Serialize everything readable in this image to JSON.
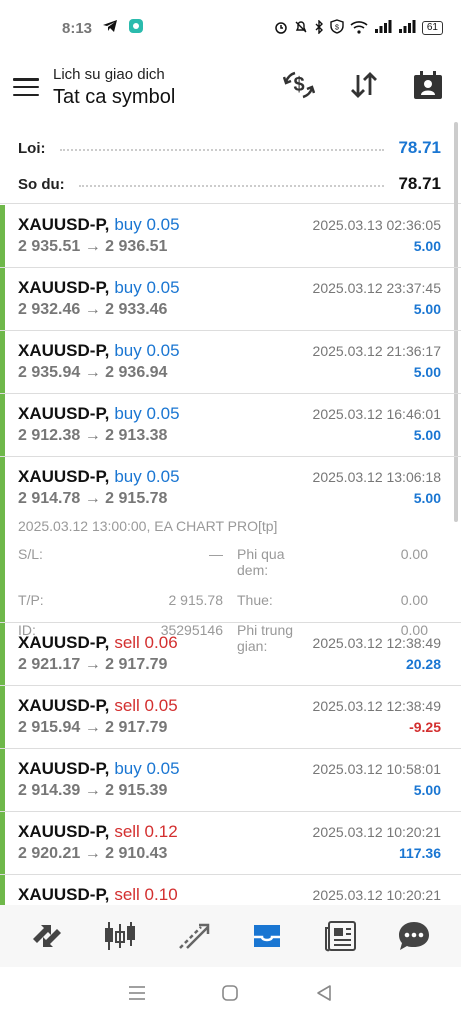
{
  "status_bar": {
    "time": "8:13",
    "battery": "61"
  },
  "header": {
    "subtitle": "Lich su giao dich",
    "title": "Tat ca symbol"
  },
  "summary": {
    "loi_label": "Loi:",
    "loi_value": "78.71",
    "sodu_label": "So du:",
    "sodu_value": "78.71"
  },
  "deals": [
    {
      "symbol": "XAUUSD-P,",
      "type": "buy 0.05",
      "side": "buy",
      "time": "2025.03.13 02:36:05",
      "prices": "2 935.51 → 2 936.51",
      "profit": "5.00",
      "profit_sign": "pos"
    },
    {
      "symbol": "XAUUSD-P,",
      "type": "buy 0.05",
      "side": "buy",
      "time": "2025.03.12 23:37:45",
      "prices": "2 932.46 → 2 933.46",
      "profit": "5.00",
      "profit_sign": "pos"
    },
    {
      "symbol": "XAUUSD-P,",
      "type": "buy 0.05",
      "side": "buy",
      "time": "2025.03.12 21:36:17",
      "prices": "2 935.94 → 2 936.94",
      "profit": "5.00",
      "profit_sign": "pos"
    },
    {
      "symbol": "XAUUSD-P,",
      "type": "buy 0.05",
      "side": "buy",
      "time": "2025.03.12 16:46:01",
      "prices": "2 912.38 → 2 913.38",
      "profit": "5.00",
      "profit_sign": "pos"
    },
    {
      "symbol": "XAUUSD-P,",
      "type": "buy 0.05",
      "side": "buy",
      "time": "2025.03.12 13:06:18",
      "prices": "2 914.78 → 2 915.78",
      "profit": "5.00",
      "profit_sign": "pos"
    },
    {
      "symbol": "XAUUSD-P,",
      "type": "sell 0.06",
      "side": "sell",
      "time": "2025.03.12 12:38:49",
      "prices": "2 921.17 → 2 917.79",
      "profit": "20.28",
      "profit_sign": "pos"
    },
    {
      "symbol": "XAUUSD-P,",
      "type": "sell 0.05",
      "side": "sell",
      "time": "2025.03.12 12:38:49",
      "prices": "2 915.94 → 2 917.79",
      "profit": "-9.25",
      "profit_sign": "neg"
    },
    {
      "symbol": "XAUUSD-P,",
      "type": "buy 0.05",
      "side": "buy",
      "time": "2025.03.12 10:58:01",
      "prices": "2 914.39 → 2 915.39",
      "profit": "5.00",
      "profit_sign": "pos"
    },
    {
      "symbol": "XAUUSD-P,",
      "type": "sell 0.12",
      "side": "sell",
      "time": "2025.03.12 10:20:21",
      "prices": "2 920.21 → 2 910.43",
      "profit": "117.36",
      "profit_sign": "pos"
    },
    {
      "symbol": "XAUUSD-P,",
      "type": "sell 0.10",
      "side": "sell",
      "time": "2025.03.12 10:20:21",
      "prices": "",
      "profit": "",
      "profit_sign": "pos"
    }
  ],
  "expanded": {
    "comment": "2025.03.12 13:00:00, EA CHART PRO[tp]",
    "sl_label": "S/L:",
    "sl_value": "—",
    "tp_label": "T/P:",
    "tp_value": "2 915.78",
    "id_label": "ID:",
    "id_value": "35295146",
    "phi_qua_dem_label": "Phi qua dem:",
    "phi_qua_dem_value": "0.00",
    "thue_label": "Thue:",
    "thue_value": "0.00",
    "phi_trung_gian_label": "Phi trung gian:",
    "phi_trung_gian_value": "0.00"
  },
  "colors": {
    "buy": "#1a76d2",
    "sell": "#d32f2f",
    "accent_bar": "#6fb84a"
  },
  "icons": {
    "actions": [
      "currency-exchange-icon",
      "sort-icon",
      "calendar-person-icon"
    ],
    "bottom_nav": [
      "quotes-icon",
      "chart-icon",
      "trade-icon",
      "history-icon",
      "news-icon",
      "chat-icon"
    ]
  },
  "active_bottom_tab": "history"
}
